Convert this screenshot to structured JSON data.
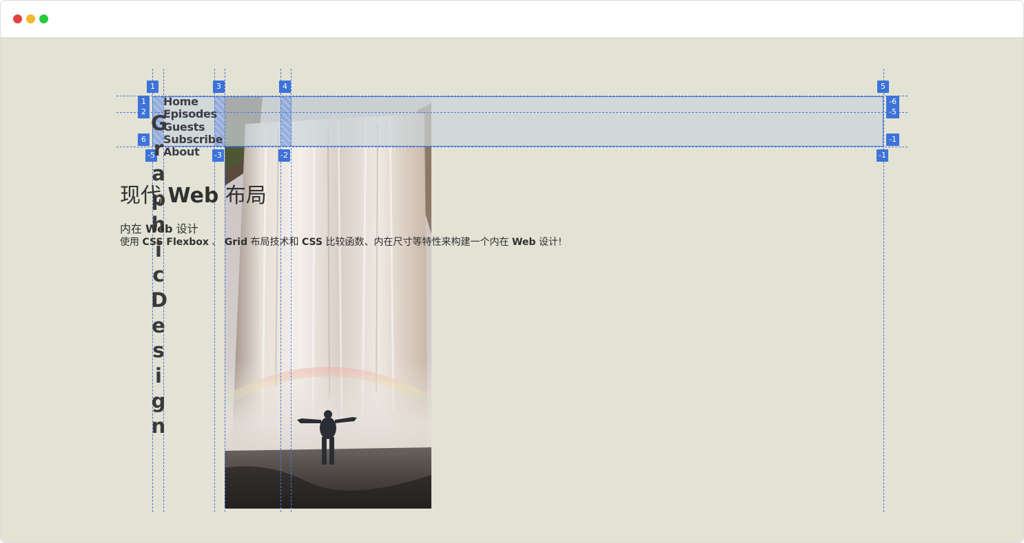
{
  "window": {
    "controls": [
      "close",
      "minimize",
      "maximize"
    ],
    "colors": {
      "close": "#e0443e",
      "minimize": "#f5b82c",
      "maximize": "#27c93f",
      "background": "#e2e2d5"
    }
  },
  "logo": {
    "text": "GraphicDesign"
  },
  "nav": {
    "items": [
      "Home",
      "Episodes",
      "Guests",
      "Subscribe",
      "About"
    ]
  },
  "heading": {
    "pre": "现代 ",
    "bold": "Web",
    "post": " 布局"
  },
  "subheading": {
    "pre": "内在 ",
    "bold": "Web",
    "post": " 设计"
  },
  "description": {
    "t1": "使用 ",
    "b1": "CSS Flexbox",
    "t2": " 、 ",
    "b2": "Grid",
    "t3": " 布局技术和 ",
    "b3": "CSS",
    "t4": " 比较函数、内在尺寸等特性来构建一个内在 ",
    "b4": "Web",
    "t5": " 设计!"
  },
  "hero_image": {
    "subject": "person-at-waterfall-photo"
  },
  "grid_overlay": {
    "accent_color": "#3d73d9",
    "column_line_numbers": [
      "1",
      "3",
      "4",
      "5"
    ],
    "column_line_numbers_negative": [
      "-5",
      "-3",
      "-2",
      "-1"
    ],
    "row_line_numbers_left": [
      "1",
      "2",
      "6"
    ],
    "row_line_numbers_right": [
      "-6",
      "-5",
      "-1"
    ]
  }
}
